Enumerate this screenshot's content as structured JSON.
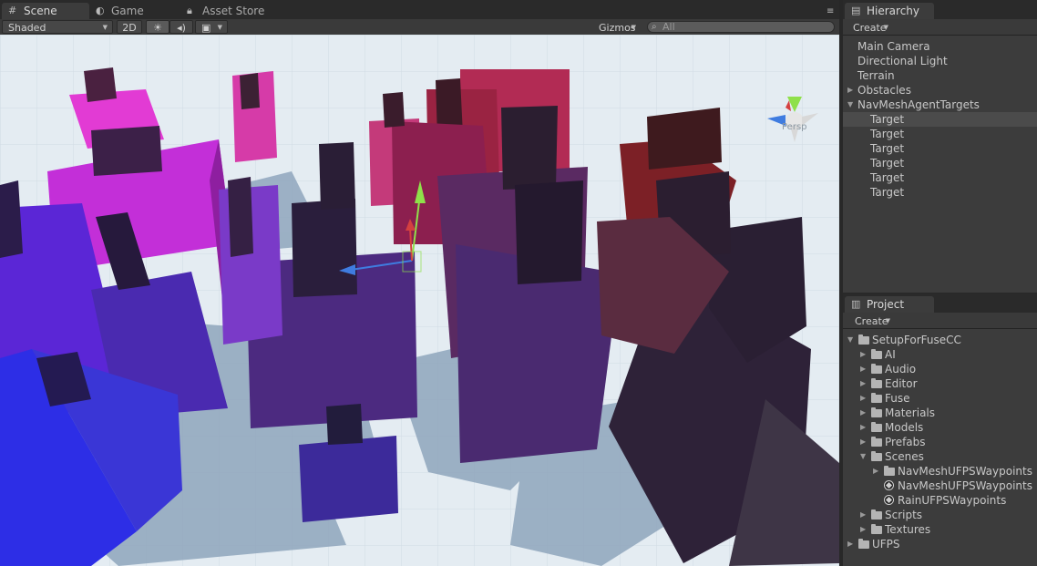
{
  "scene_window": {
    "tabs": [
      {
        "label": "Scene",
        "icon": "grid-icon"
      },
      {
        "label": "Game",
        "icon": "pacman-icon"
      },
      {
        "label": "Asset Store",
        "icon": "lock-icon"
      }
    ],
    "toolbar": {
      "draw_mode": "Shaded",
      "mode_2d": "2D",
      "lighting_icon": "sun-icon",
      "audio_icon": "speaker-icon",
      "effects_icon": "image-icon",
      "gizmos": "Gizmos",
      "search_placeholder": "All"
    },
    "view_label": "Persp"
  },
  "hierarchy": {
    "tab": "Hierarchy",
    "create": "Create",
    "items": [
      {
        "label": "Main Camera",
        "depth": 0,
        "fold": ""
      },
      {
        "label": "Directional Light",
        "depth": 0,
        "fold": ""
      },
      {
        "label": "Terrain",
        "depth": 0,
        "fold": ""
      },
      {
        "label": "Obstacles",
        "depth": 0,
        "fold": "collapsed"
      },
      {
        "label": "NavMeshAgentTargets",
        "depth": 0,
        "fold": "expanded"
      },
      {
        "label": "Target",
        "depth": 1,
        "fold": "",
        "selected": true
      },
      {
        "label": "Target",
        "depth": 1,
        "fold": ""
      },
      {
        "label": "Target",
        "depth": 1,
        "fold": ""
      },
      {
        "label": "Target",
        "depth": 1,
        "fold": ""
      },
      {
        "label": "Target",
        "depth": 1,
        "fold": ""
      },
      {
        "label": "Target",
        "depth": 1,
        "fold": ""
      }
    ]
  },
  "project": {
    "tab": "Project",
    "create": "Create",
    "items": [
      {
        "label": "SetupForFuseCC",
        "depth": 0,
        "fold": "expanded",
        "type": "folder"
      },
      {
        "label": "AI",
        "depth": 1,
        "fold": "collapsed",
        "type": "folder"
      },
      {
        "label": "Audio",
        "depth": 1,
        "fold": "collapsed",
        "type": "folder"
      },
      {
        "label": "Editor",
        "depth": 1,
        "fold": "collapsed",
        "type": "folder"
      },
      {
        "label": "Fuse",
        "depth": 1,
        "fold": "collapsed",
        "type": "folder"
      },
      {
        "label": "Materials",
        "depth": 1,
        "fold": "collapsed",
        "type": "folder"
      },
      {
        "label": "Models",
        "depth": 1,
        "fold": "collapsed",
        "type": "folder"
      },
      {
        "label": "Prefabs",
        "depth": 1,
        "fold": "collapsed",
        "type": "folder"
      },
      {
        "label": "Scenes",
        "depth": 1,
        "fold": "expanded",
        "type": "folder"
      },
      {
        "label": "NavMeshUFPSWaypoints",
        "depth": 2,
        "fold": "collapsed",
        "type": "folder"
      },
      {
        "label": "NavMeshUFPSWaypoints",
        "depth": 2,
        "fold": "",
        "type": "scene"
      },
      {
        "label": "RainUFPSWaypoints",
        "depth": 2,
        "fold": "",
        "type": "scene"
      },
      {
        "label": "Scripts",
        "depth": 1,
        "fold": "collapsed",
        "type": "folder"
      },
      {
        "label": "Textures",
        "depth": 1,
        "fold": "collapsed",
        "type": "folder"
      },
      {
        "label": "UFPS",
        "depth": 0,
        "fold": "collapsed",
        "type": "folder"
      }
    ]
  },
  "colors": {
    "panel_bg": "#3c3c3c",
    "tab_bar": "#2a2a2a",
    "selection": "#4b4b4b",
    "text": "#c8c8c8",
    "ground": "#e4ecf2",
    "shadow": "#8fa6bd"
  }
}
